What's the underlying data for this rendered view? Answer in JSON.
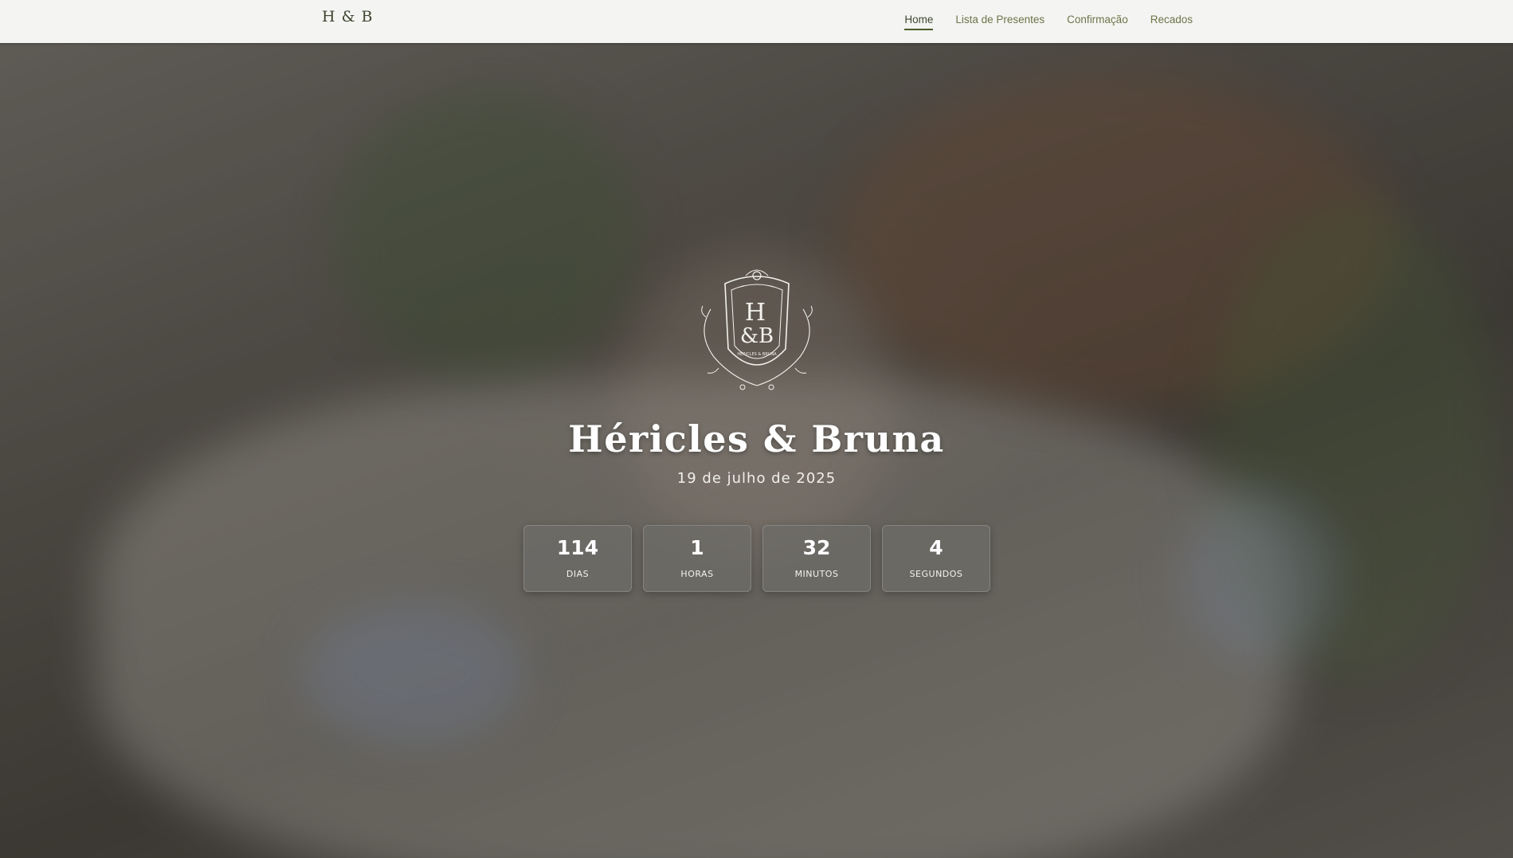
{
  "nav": {
    "brand": "H & B",
    "links": [
      {
        "label": "Home",
        "active": true
      },
      {
        "label": "Lista de Presentes",
        "active": false
      },
      {
        "label": "Confirmação",
        "active": false
      },
      {
        "label": "Recados",
        "active": false
      }
    ]
  },
  "hero": {
    "crest": {
      "monogram_top": "H",
      "monogram_bottom": "&B",
      "caption": "HÉRICLES & BRUNA"
    },
    "names": "Héricles & Bruna",
    "date": "19 de julho de 2025",
    "countdown": [
      {
        "value": "114",
        "label": "DIAS"
      },
      {
        "value": "1",
        "label": "HORAS"
      },
      {
        "value": "32",
        "label": "MINUTOS"
      },
      {
        "value": "4",
        "label": "SEGUNDOS"
      }
    ]
  },
  "colors": {
    "nav_background": "#f4f4f2",
    "nav_text": "#6b7548",
    "nav_active": "#3e4630",
    "hero_overlay": "#4b4842",
    "countdown_box": "#6e6c68"
  }
}
